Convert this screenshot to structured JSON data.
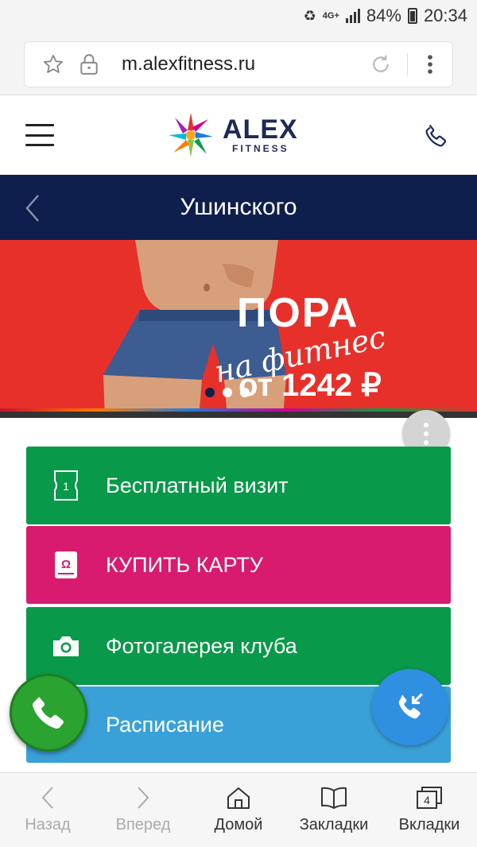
{
  "status_bar": {
    "network": "4G+",
    "battery": "84%",
    "time": "20:34"
  },
  "browser": {
    "url": "m.alexfitness.ru"
  },
  "header": {
    "logo_main": "ALEX",
    "logo_sub": "FITNESS"
  },
  "title_bar": {
    "title": "Ушинского"
  },
  "banner": {
    "line1": "ПОРА",
    "line2": "на фитнес",
    "line3": "от 1242 ₽",
    "slide_count": 3,
    "active_slide": 1
  },
  "menu": {
    "items": [
      {
        "label": "Бесплатный визит",
        "icon": "ticket-icon",
        "color": "#08994a"
      },
      {
        "label": "КУПИТЬ КАРТУ",
        "icon": "card-icon",
        "color": "#d81b6e"
      },
      {
        "label": "Фотогалерея клуба",
        "icon": "camera-icon",
        "color": "#08994a"
      },
      {
        "label": "Расписание",
        "icon": "calendar-icon",
        "color": "#3aa1d8"
      }
    ]
  },
  "bottom_nav": {
    "back": "Назад",
    "forward": "Вперед",
    "home": "Домой",
    "bookmarks": "Закладки",
    "tabs": "Вкладки",
    "tabs_count": "4"
  },
  "colors": {
    "navy": "#0e1f4d",
    "banner_red": "#e8302a",
    "green": "#08994a",
    "pink": "#d81b6e",
    "blue": "#3aa1d8",
    "call_green": "#2aa330",
    "callback_blue": "#2f8fe0"
  }
}
